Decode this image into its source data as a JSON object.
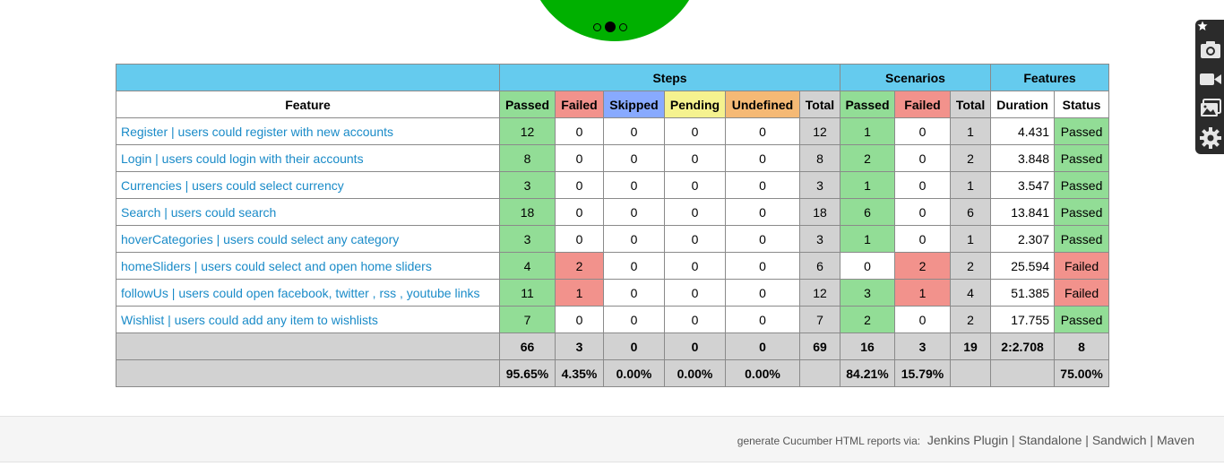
{
  "carousel": {
    "slide_count": 3,
    "active_index": 1
  },
  "table": {
    "group_headers": {
      "steps": "Steps",
      "scenarios": "Scenarios",
      "features": "Features"
    },
    "column_headers": {
      "feature": "Feature",
      "steps_passed": "Passed",
      "steps_failed": "Failed",
      "steps_skipped": "Skipped",
      "steps_pending": "Pending",
      "steps_undefined": "Undefined",
      "steps_total": "Total",
      "sc_passed": "Passed",
      "sc_failed": "Failed",
      "sc_total": "Total",
      "duration": "Duration",
      "status": "Status"
    },
    "rows": [
      {
        "feature": "Register | users could register with new accounts",
        "steps": [
          "12",
          "0",
          "0",
          "0",
          "0",
          "12"
        ],
        "scenarios": [
          "1",
          "0",
          "1"
        ],
        "duration": "4.431",
        "status": "Passed"
      },
      {
        "feature": "Login | users could login with their accounts",
        "steps": [
          "8",
          "0",
          "0",
          "0",
          "0",
          "8"
        ],
        "scenarios": [
          "2",
          "0",
          "2"
        ],
        "duration": "3.848",
        "status": "Passed"
      },
      {
        "feature": "Currencies | users could select currency",
        "steps": [
          "3",
          "0",
          "0",
          "0",
          "0",
          "3"
        ],
        "scenarios": [
          "1",
          "0",
          "1"
        ],
        "duration": "3.547",
        "status": "Passed"
      },
      {
        "feature": "Search | users could search",
        "steps": [
          "18",
          "0",
          "0",
          "0",
          "0",
          "18"
        ],
        "scenarios": [
          "6",
          "0",
          "6"
        ],
        "duration": "13.841",
        "status": "Passed"
      },
      {
        "feature": "hoverCategories | users could select any category",
        "steps": [
          "3",
          "0",
          "0",
          "0",
          "0",
          "3"
        ],
        "scenarios": [
          "1",
          "0",
          "1"
        ],
        "duration": "2.307",
        "status": "Passed"
      },
      {
        "feature": "homeSliders | users could select and open home sliders",
        "steps": [
          "4",
          "2",
          "0",
          "0",
          "0",
          "6"
        ],
        "scenarios": [
          "0",
          "2",
          "2"
        ],
        "duration": "25.594",
        "status": "Failed"
      },
      {
        "feature": "followUs | users could open facebook, twitter , rss , youtube links",
        "steps": [
          "11",
          "1",
          "0",
          "0",
          "0",
          "12"
        ],
        "scenarios": [
          "3",
          "1",
          "4"
        ],
        "duration": "51.385",
        "status": "Failed"
      },
      {
        "feature": "Wishlist | users could add any item to wishlists",
        "steps": [
          "7",
          "0",
          "0",
          "0",
          "0",
          "7"
        ],
        "scenarios": [
          "2",
          "0",
          "2"
        ],
        "duration": "17.755",
        "status": "Passed"
      }
    ],
    "totals": {
      "steps": [
        "66",
        "3",
        "0",
        "0",
        "0",
        "69"
      ],
      "scenarios": [
        "16",
        "3",
        "19"
      ],
      "duration": "2:2.708",
      "status": "8"
    },
    "percentages": {
      "steps": [
        "95.65%",
        "4.35%",
        "0.00%",
        "0.00%",
        "0.00%",
        ""
      ],
      "scenarios": [
        "84.21%",
        "15.79%",
        ""
      ],
      "duration": "",
      "status": "75.00%"
    }
  },
  "footer": {
    "prefix": "generate Cucumber HTML reports via:",
    "links": [
      "Jenkins Plugin",
      "Standalone",
      "Sandwich",
      "Maven"
    ],
    "separator": " | "
  },
  "toolbar": {
    "icons": [
      "camera-icon",
      "video-icon",
      "image-icon",
      "gear-icon"
    ]
  },
  "colors": {
    "passed": "#92dd96",
    "failed": "#f2928c",
    "skipped": "#88aaff",
    "pending": "#f5f28f",
    "undefined": "#f5b975",
    "total": "#d2d2d2",
    "header": "#65cbee",
    "link": "#1a8bc8",
    "carousel": "#00b000"
  }
}
